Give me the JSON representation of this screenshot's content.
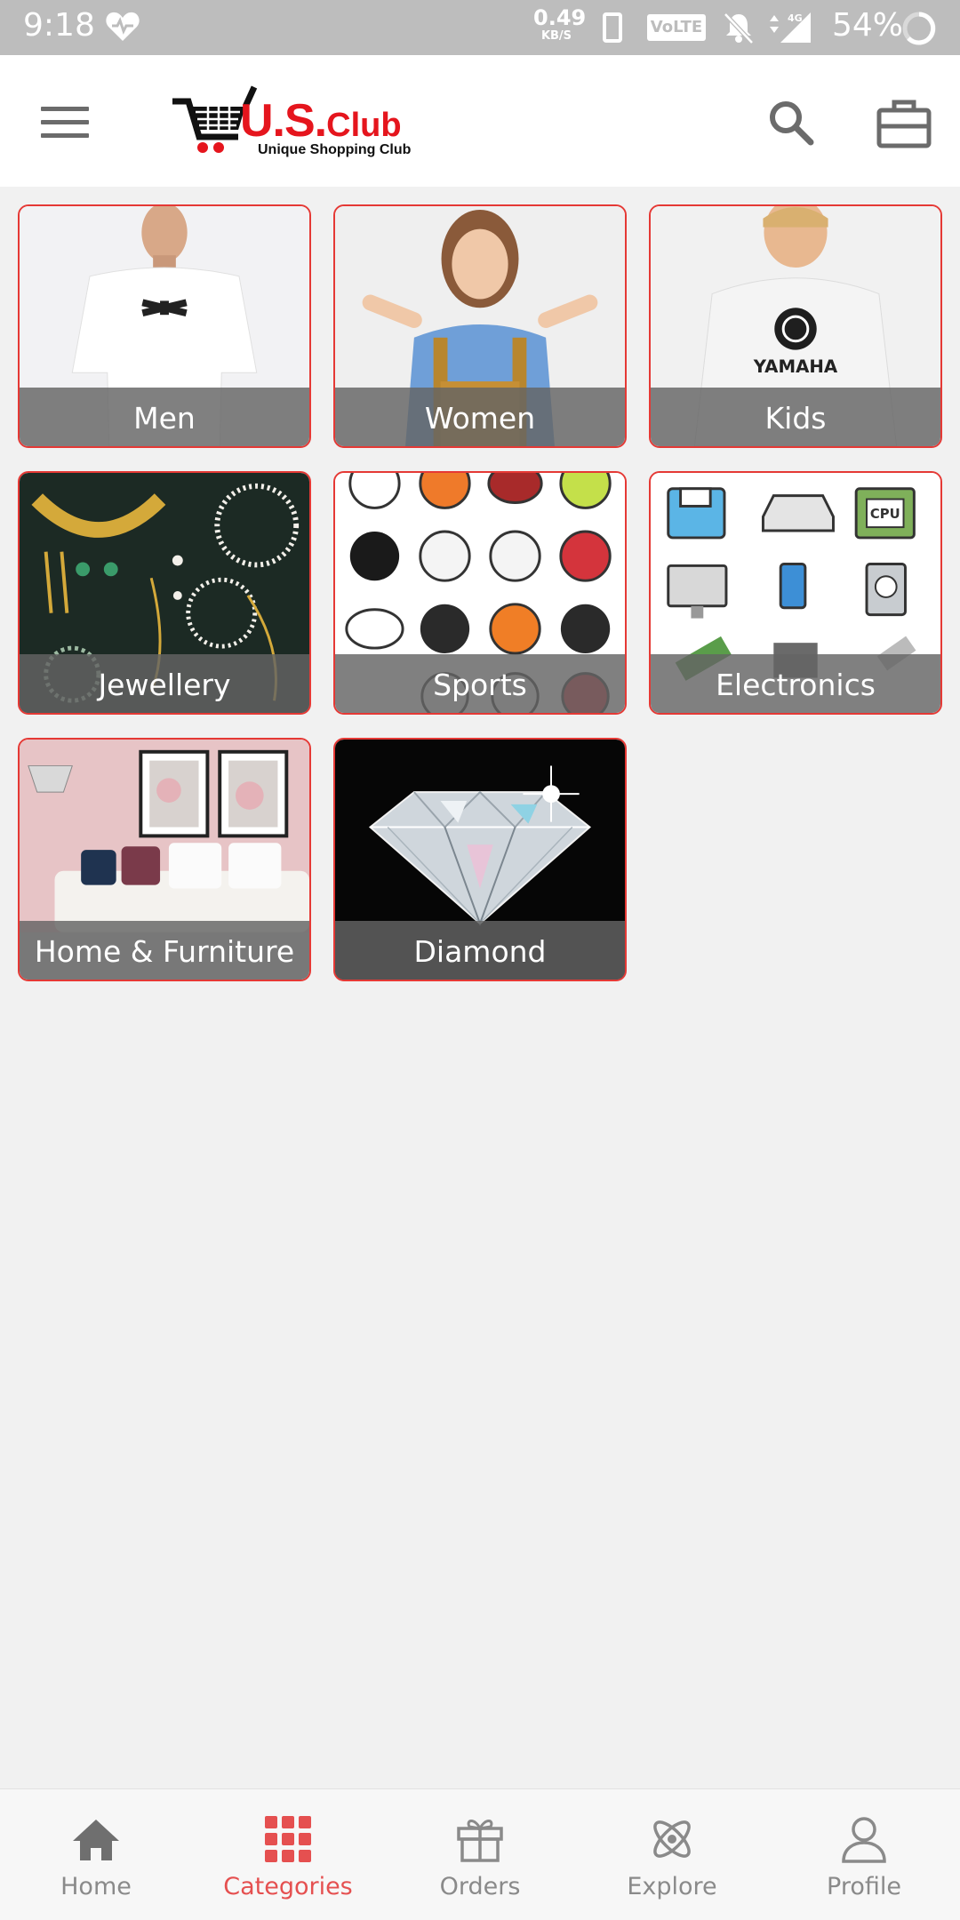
{
  "status_bar": {
    "time": "9:18",
    "net_speed_value": "0.49",
    "net_speed_unit": "KB/S",
    "volte": "VoLTE",
    "network": "4G",
    "battery": "54%"
  },
  "app_bar": {
    "logo_main": "U.S.",
    "logo_club": "Club",
    "logo_tagline": "Unique Shopping Club"
  },
  "categories": [
    {
      "label": "Men"
    },
    {
      "label": "Women"
    },
    {
      "label": "Kids"
    },
    {
      "label": "Jewellery"
    },
    {
      "label": "Sports"
    },
    {
      "label": "Electronics"
    },
    {
      "label": "Home & Furniture"
    },
    {
      "label": "Diamond"
    }
  ],
  "bottom_nav": {
    "items": [
      {
        "label": "Home",
        "icon": "home-icon"
      },
      {
        "label": "Categories",
        "icon": "grid-icon"
      },
      {
        "label": "Orders",
        "icon": "gift-icon"
      },
      {
        "label": "Explore",
        "icon": "atom-icon"
      },
      {
        "label": "Profile",
        "icon": "user-icon"
      }
    ],
    "active": "Categories"
  },
  "colors": {
    "accent": "#e53935",
    "status_bar": "#bdbdbd",
    "background": "#f1f1f1"
  }
}
